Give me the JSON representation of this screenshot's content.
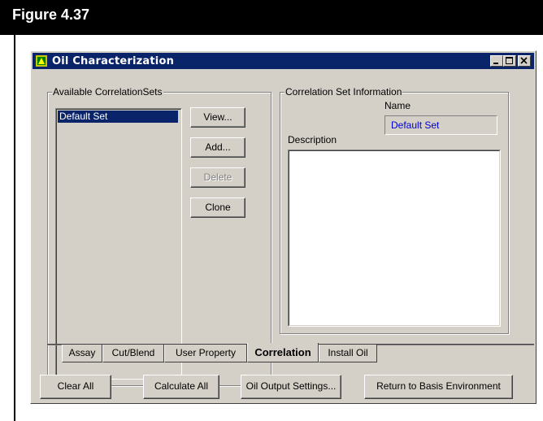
{
  "figure": {
    "label": "Figure 4.37"
  },
  "window": {
    "title": "Oil Characterization",
    "controls": {
      "minimize": "minimize-icon",
      "maximize": "maximize-icon",
      "close": "close-icon"
    }
  },
  "available_sets": {
    "label": "Available CorrelationSets",
    "items": [
      "Default Set"
    ],
    "buttons": {
      "view": "View...",
      "add": "Add...",
      "delete": "Delete",
      "clone": "Clone"
    }
  },
  "set_info": {
    "label": "Correlation Set Information",
    "name_label": "Name",
    "name_value": "Default Set",
    "description_label": "Description",
    "description_value": ""
  },
  "tabs": [
    {
      "label": "Assay",
      "active": false
    },
    {
      "label": "Cut/Blend",
      "active": false
    },
    {
      "label": "User Property",
      "active": false
    },
    {
      "label": "Correlation",
      "active": true
    },
    {
      "label": "Install Oil",
      "active": false
    }
  ],
  "footer": {
    "clear_all": "Clear All",
    "calculate_all": "Calculate All",
    "oil_output_settings": "Oil Output Settings...",
    "return_basis": "Return to Basis Environment"
  },
  "colors": {
    "titlebar": "#0a246a",
    "face": "#d4d0c8",
    "name_text": "#0000cc"
  }
}
